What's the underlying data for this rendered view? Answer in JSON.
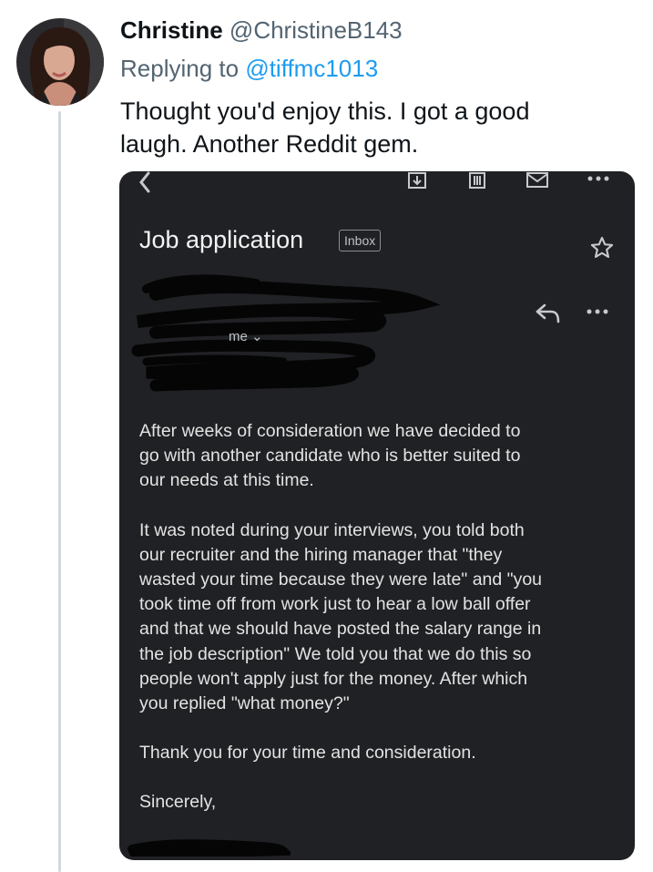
{
  "author": {
    "name": "Christine",
    "handle": "@ChristineB143"
  },
  "reply": {
    "prefix": "Replying to",
    "handle": "@tiffmc1013"
  },
  "tweet": {
    "text": "Thought you'd enjoy this. I got a good\nlaugh. Another Reddit gem."
  },
  "email": {
    "toolbar_icons": [
      "back-icon",
      "archive-icon",
      "delete-icon",
      "mail-icon",
      "more-icon"
    ],
    "subject": "Job application",
    "label": "Inbox",
    "recipient": "me",
    "paragraphs": [
      "After weeks of consideration we have decided to\ngo with another candidate who is better suited to\nour needs at this time.",
      "It was noted during your interviews, you told both\nour recruiter and the hiring manager that \"they\nwasted your time because they were late\" and \"you\ntook time off from work just to hear a low ball offer\nand that we should have posted the salary range in\nthe job description\" We told you that we do this so\npeople won't apply just for the money. After which\nyou replied \"what money?\"",
      "Thank you for your time and consideration.",
      "Sincerely,"
    ]
  },
  "colors": {
    "link": "#1d9bf0",
    "email_bg": "#202124",
    "thread_line": "#cfd9de"
  }
}
